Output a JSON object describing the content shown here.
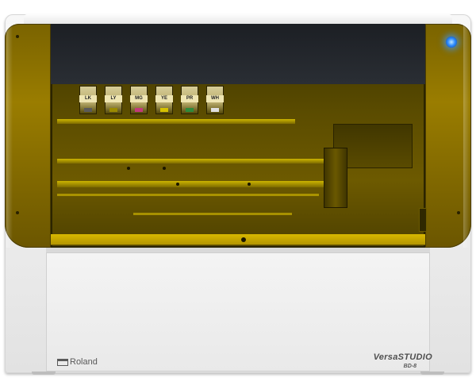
{
  "brand": {
    "logo_text": "Roland",
    "model_name": "VersaSTUDIO",
    "model_code": "BD-8"
  },
  "ink_cartridges": [
    {
      "label": "LK",
      "tab_color": "#5a5a5a"
    },
    {
      "label": "LY",
      "tab_color": "#9a8a00"
    },
    {
      "label": "MG",
      "tab_color": "#c23a7a"
    },
    {
      "label": "YE",
      "tab_color": "#d6c200"
    },
    {
      "label": "PR",
      "tab_color": "#2e8a3c"
    },
    {
      "label": "WH",
      "tab_color": "#e0e0e0"
    }
  ],
  "colors": {
    "cover_tint": "#9a7d00",
    "power_light": "#2e8dff",
    "body": "#ececec"
  },
  "icons": {
    "power": "power-button-light"
  }
}
